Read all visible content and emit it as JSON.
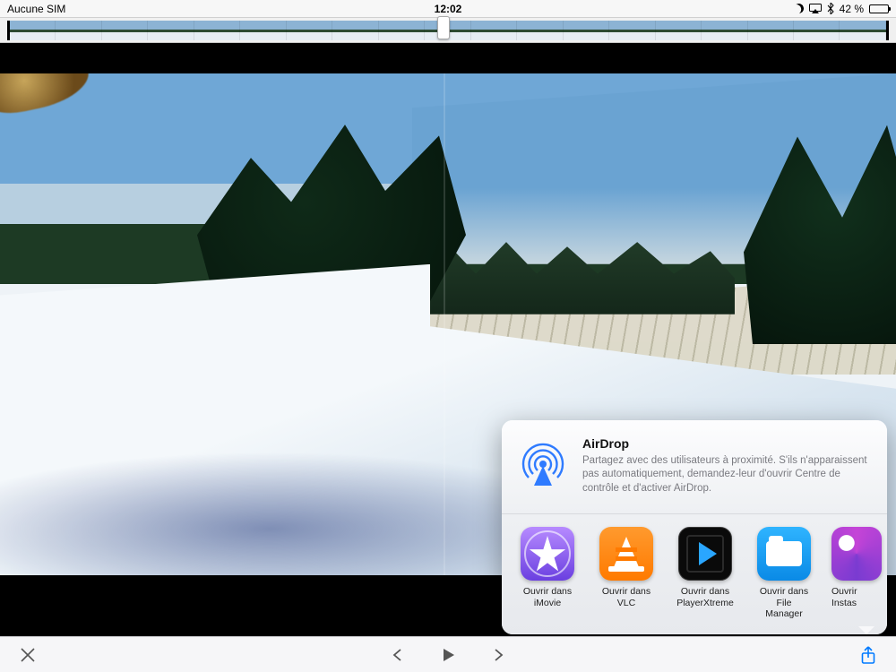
{
  "status": {
    "carrier": "Aucune SIM",
    "time": "12:02",
    "battery_text": "42 %",
    "battery_fill_pct": 42,
    "dnd": true,
    "airplay": true,
    "bluetooth": true
  },
  "filmstrip": {
    "thumb_count": 19,
    "scrub_position_pct": 48
  },
  "share_sheet": {
    "airdrop": {
      "title": "AirDrop",
      "desc": "Partagez avec des utilisateurs à proximité. S'ils n'apparaissent pas automatiquement, demandez-leur d'ouvrir Centre de contrôle et d'activer AirDrop."
    },
    "apps": [
      {
        "id": "imovie",
        "label_l1": "Ouvrir dans",
        "label_l2": "iMovie"
      },
      {
        "id": "vlc",
        "label_l1": "Ouvrir dans",
        "label_l2": "VLC"
      },
      {
        "id": "playerxtreme",
        "label_l1": "Ouvrir dans",
        "label_l2": "PlayerXtreme"
      },
      {
        "id": "filemanager",
        "label_l1": "Ouvrir dans File",
        "label_l2": "Manager"
      },
      {
        "id": "instash",
        "label_l1": "Ouvrir",
        "label_l2": "Instas"
      }
    ]
  },
  "toolbar": {
    "close": "close",
    "prev": "prev",
    "play": "play",
    "next": "next",
    "share": "share"
  }
}
